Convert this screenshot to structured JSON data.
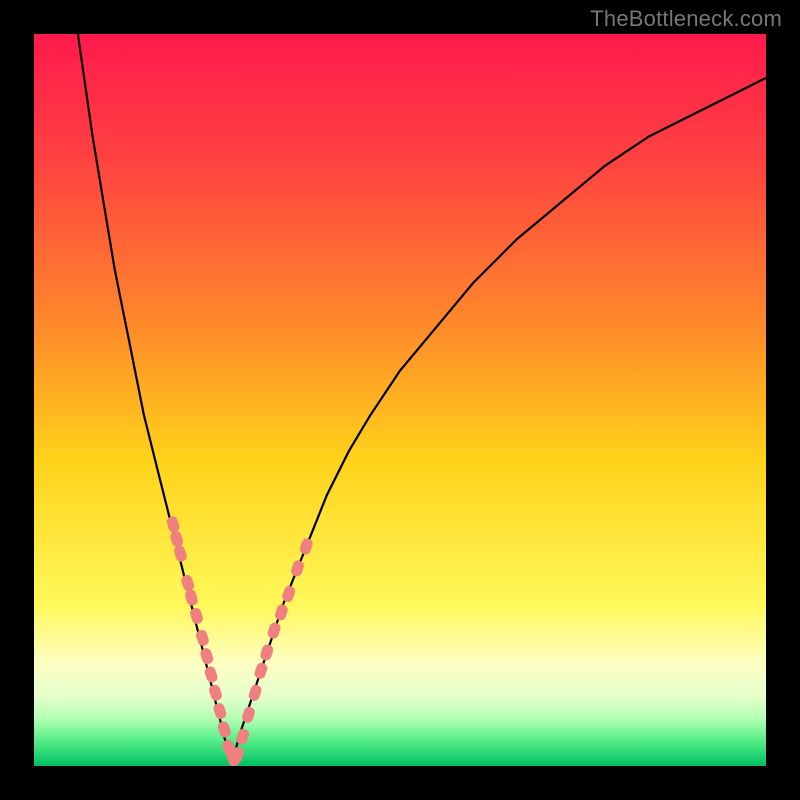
{
  "watermark": "TheBottleneck.com",
  "chart_data": {
    "type": "line",
    "title": "",
    "xlabel": "",
    "ylabel": "",
    "xlim": [
      0,
      100
    ],
    "ylim": [
      0,
      100
    ],
    "grid": false,
    "legend": false,
    "gradient_stops": [
      {
        "pos": 0.0,
        "color": "#ff1a4c"
      },
      {
        "pos": 0.18,
        "color": "#ff4440"
      },
      {
        "pos": 0.4,
        "color": "#ff8a2a"
      },
      {
        "pos": 0.58,
        "color": "#ffd21a"
      },
      {
        "pos": 0.78,
        "color": "#fff85a"
      },
      {
        "pos": 0.86,
        "color": "#fdffc2"
      },
      {
        "pos": 0.905,
        "color": "#e4ffcb"
      },
      {
        "pos": 0.935,
        "color": "#b3ffb3"
      },
      {
        "pos": 0.965,
        "color": "#55ee88"
      },
      {
        "pos": 1.0,
        "color": "#00c060"
      }
    ],
    "series": [
      {
        "name": "left-curve",
        "x": [
          6,
          7,
          8,
          9,
          10,
          11,
          12,
          13,
          14,
          15,
          16,
          17,
          18,
          19,
          20,
          21,
          22,
          23,
          24,
          25,
          26,
          27
        ],
        "y": [
          100,
          93,
          86,
          80,
          74,
          68,
          63,
          58,
          53,
          48,
          44,
          40,
          36,
          32,
          28,
          24,
          20,
          16,
          12,
          8,
          4,
          0
        ]
      },
      {
        "name": "right-curve",
        "x": [
          27,
          28,
          30,
          32,
          34,
          36,
          38,
          40,
          43,
          46,
          50,
          55,
          60,
          66,
          72,
          78,
          84,
          90,
          96,
          100
        ],
        "y": [
          0,
          4,
          10,
          16,
          22,
          27,
          32,
          37,
          43,
          48,
          54,
          60,
          66,
          72,
          77,
          82,
          86,
          89,
          92,
          94
        ]
      },
      {
        "name": "highlight-markers-left",
        "x": [
          19.0,
          19.5,
          20.0,
          21.0,
          21.5,
          22.2,
          23.0,
          23.6,
          24.2,
          24.8,
          25.4,
          26.0,
          26.6,
          27.2
        ],
        "y": [
          33.0,
          31.0,
          29.0,
          25.0,
          23.0,
          20.5,
          17.5,
          15.0,
          12.5,
          10.0,
          7.5,
          5.0,
          2.5,
          1.0
        ]
      },
      {
        "name": "highlight-markers-right",
        "x": [
          27.8,
          28.5,
          29.3,
          30.2,
          31.0,
          31.8,
          32.8,
          33.8,
          34.8,
          36.0,
          37.2
        ],
        "y": [
          1.5,
          4.0,
          7.0,
          10.0,
          13.0,
          15.5,
          18.5,
          21.0,
          23.5,
          27.0,
          30.0
        ]
      }
    ],
    "annotations": []
  }
}
